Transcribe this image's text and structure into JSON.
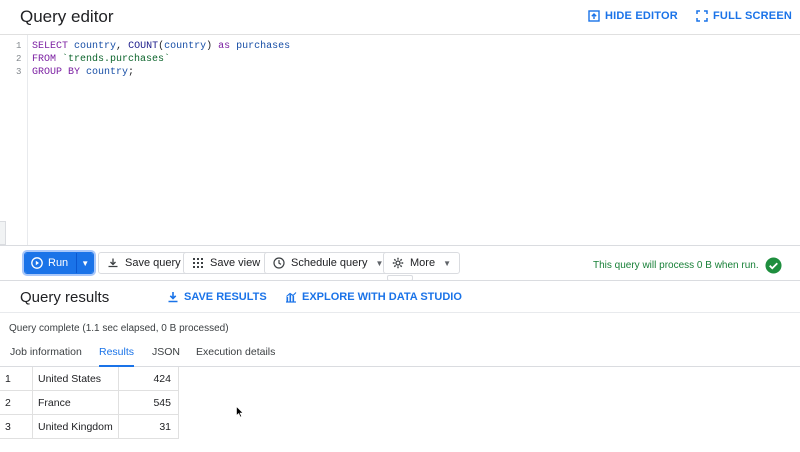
{
  "header": {
    "title": "Query editor",
    "hide_editor": "HIDE EDITOR",
    "full_screen": "FULL SCREEN"
  },
  "editor": {
    "lines": [
      {
        "num": "1",
        "tokens": [
          [
            "kw",
            "SELECT"
          ],
          [
            "plain",
            " "
          ],
          [
            "id",
            "country"
          ],
          [
            "plain",
            ", "
          ],
          [
            "fn",
            "COUNT"
          ],
          [
            "plain",
            "("
          ],
          [
            "id",
            "country"
          ],
          [
            "plain",
            ") "
          ],
          [
            "kw",
            "as"
          ],
          [
            "plain",
            " "
          ],
          [
            "id",
            "purchases"
          ]
        ]
      },
      {
        "num": "2",
        "tokens": [
          [
            "kw",
            "FROM"
          ],
          [
            "plain",
            " "
          ],
          [
            "str",
            "`trends.purchases`"
          ]
        ]
      },
      {
        "num": "3",
        "tokens": [
          [
            "kw",
            "GROUP BY"
          ],
          [
            "plain",
            " "
          ],
          [
            "id",
            "country"
          ],
          [
            "plain",
            ";"
          ]
        ]
      }
    ]
  },
  "toolbar": {
    "run": "Run",
    "save_query": "Save query",
    "save_view": "Save view",
    "schedule_query": "Schedule query",
    "more": "More",
    "process_message": "This query will process 0 B when run."
  },
  "results": {
    "title": "Query results",
    "save_results": "SAVE RESULTS",
    "explore": "EXPLORE WITH DATA STUDIO",
    "status": "Query complete (1.1 sec elapsed, 0 B processed)",
    "tabs": [
      "Job information",
      "Results",
      "JSON",
      "Execution details"
    ],
    "active_tab": "Results",
    "rows": [
      {
        "idx": "1",
        "country": "United States",
        "purchases": "424"
      },
      {
        "idx": "2",
        "country": "France",
        "purchases": "545"
      },
      {
        "idx": "3",
        "country": "United Kingdom",
        "purchases": "31"
      }
    ]
  },
  "colors": {
    "accent": "#1a73e8",
    "success": "#188038"
  },
  "icons": {
    "hide_editor": "hide-editor-icon",
    "full_screen": "fullscreen-icon",
    "run": "play-icon",
    "save_query": "save-icon",
    "save_view": "grid-icon",
    "schedule_query": "clock-icon",
    "more": "gear-icon",
    "valid": "check-circle-icon",
    "save_results": "download-icon",
    "explore": "chart-icon"
  }
}
